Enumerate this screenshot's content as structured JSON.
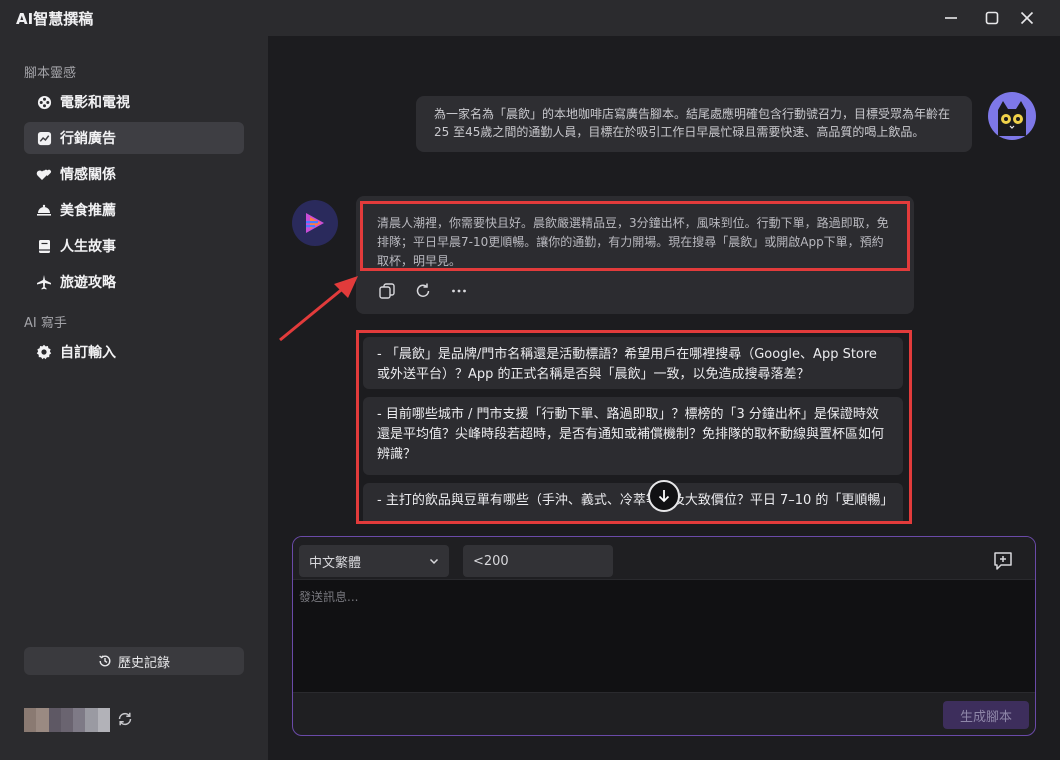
{
  "app": {
    "title": "AI智慧撰稿"
  },
  "sidebar": {
    "section_inspiration": "腳本靈感",
    "section_ai": "AI 寫手",
    "items": [
      {
        "label": "電影和電視",
        "icon": "film-reel-icon"
      },
      {
        "label": "行銷廣告",
        "icon": "trend-chart-icon",
        "active": true
      },
      {
        "label": "情感關係",
        "icon": "hearts-icon"
      },
      {
        "label": "美食推薦",
        "icon": "food-cloche-icon"
      },
      {
        "label": "人生故事",
        "icon": "book-icon"
      },
      {
        "label": "旅遊攻略",
        "icon": "airplane-icon"
      }
    ],
    "custom_item": {
      "label": "自訂輸入",
      "icon": "gear-icon"
    },
    "history_label": "歷史記錄"
  },
  "chat": {
    "user_message": "為一家名為「晨飲」的本地咖啡店寫廣告腳本。結尾處應明確包含行動號召力，目標受眾為年齡在25 至45歲之間的通勤人員，目標在於吸引工作日早晨忙碌且需要快速、高品質的喝上飲品。",
    "bot_reply": "清晨人潮裡，你需要快且好。晨飲嚴選精品豆，3分鐘出杯，風味到位。行動下單，路過即取，免排隊；平日早晨7-10更順暢。讓你的通勤，有力開場。現在搜尋「晨飲」或開啟App下單，預約取杯，明早見。",
    "questions": [
      "- 「晨飲」是品牌/門市名稱還是活動標語？希望用戶在哪裡搜尋（Google、App Store 或外送平台）？App 的正式名稱是否與「晨飲」一致，以免造成搜尋落差？",
      "- 目前哪些城市 / 門市支援「行動下單、路過即取」？標榜的「3 分鐘出杯」是保證時效還是平均值？尖峰時段若超時，是否有通知或補償機制？免排隊的取杯動線與置杯區如何辨識？",
      "- 主打的飲品與豆單有哪些（手沖、義式、冷萃等）及大致價位？平日 7–10 的「更順暢」"
    ]
  },
  "composer": {
    "language_value": "中文繁體",
    "length_value": "<200",
    "placeholder": "發送訊息...",
    "generate_label": "生成腳本"
  },
  "colors": {
    "accent_border": "#6a4aa8",
    "highlight_red": "#e23b3b",
    "active_nav": "#3e3e43"
  }
}
